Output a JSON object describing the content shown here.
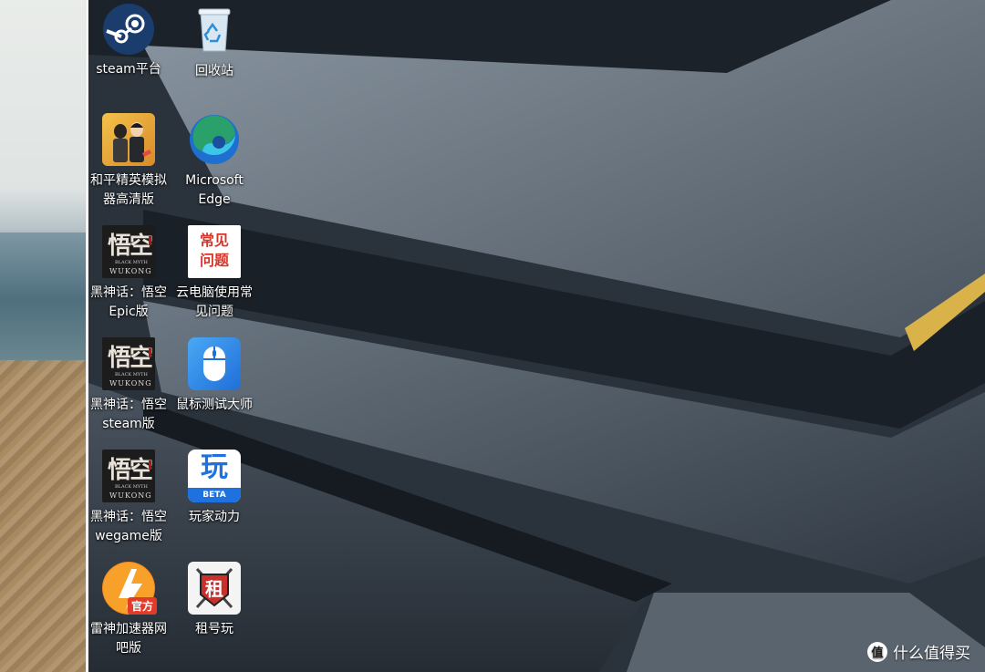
{
  "desktop_icons": [
    {
      "id": "steam",
      "label": "steam平台",
      "icon": "steam-icon"
    },
    {
      "id": "recycle-bin",
      "label": "回收站",
      "icon": "recycle-bin-icon"
    },
    {
      "id": "peace-elite",
      "label": "和平精英模拟器高清版",
      "icon": "game-icon"
    },
    {
      "id": "edge",
      "label": "Microsoft Edge",
      "icon": "edge-icon"
    },
    {
      "id": "wukong-epic",
      "label": "黑神话：悟空Epic版",
      "icon": "wukong-icon"
    },
    {
      "id": "faq",
      "label": "云电脑使用常见问题",
      "icon": "faq-icon",
      "icon_text": "常见问题"
    },
    {
      "id": "wukong-steam",
      "label": "黑神话：悟空steam版",
      "icon": "wukong-icon"
    },
    {
      "id": "mouse-test",
      "label": "鼠标测试大师",
      "icon": "mouse-icon"
    },
    {
      "id": "wukong-wegame",
      "label": "黑神话：悟空wegame版",
      "icon": "wukong-icon"
    },
    {
      "id": "player-boost",
      "label": "玩家动力",
      "icon": "player-boost-icon",
      "icon_text": "玩",
      "badge": "BETA"
    },
    {
      "id": "leishen",
      "label": "雷神加速器网吧版",
      "icon": "leishen-icon",
      "badge": "官方"
    },
    {
      "id": "zuhaowan",
      "label": "租号玩",
      "icon": "zuhaowan-icon",
      "icon_text": "租"
    }
  ],
  "wukong_icon": {
    "title": "悟空",
    "subtitle": "BLACK MYTH",
    "name": "WUKONG"
  },
  "watermark": {
    "logo": "值",
    "text": "什么值得买"
  },
  "colors": {
    "accent_gold": "#d9b24a",
    "steam_blue": "#1b3d6e",
    "edge_teal": "#2aa06b",
    "faq_red": "#d8352a"
  }
}
